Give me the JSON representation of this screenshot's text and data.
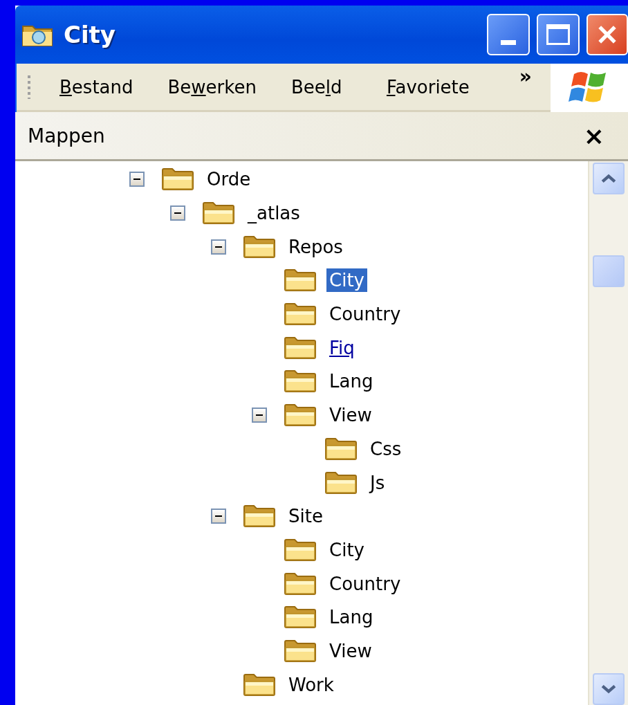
{
  "window": {
    "title": "City"
  },
  "menu": [
    {
      "segments": [
        {
          "text": "B",
          "underlined": true
        },
        {
          "text": "estand",
          "underlined": false
        }
      ]
    },
    {
      "segments": [
        {
          "text": "Be",
          "underlined": false
        },
        {
          "text": "w",
          "underlined": true
        },
        {
          "text": "erken",
          "underlined": false
        }
      ]
    },
    {
      "segments": [
        {
          "text": "Bee",
          "underlined": false
        },
        {
          "text": "l",
          "underlined": true
        },
        {
          "text": "d",
          "underlined": false
        }
      ]
    },
    {
      "segments": [
        {
          "text": "F",
          "underlined": true
        },
        {
          "text": "avoriete",
          "underlined": false
        }
      ]
    }
  ],
  "menu_overflow": "»",
  "folders_pane": {
    "title": "Mappen",
    "close": "×"
  },
  "tree": [
    {
      "label": "Orde",
      "expanded": true,
      "selected": false,
      "hovered": false,
      "children": [
        {
          "label": "_atlas",
          "expanded": true,
          "selected": false,
          "hovered": false,
          "children": [
            {
              "label": "Repos",
              "expanded": true,
              "selected": false,
              "hovered": false,
              "children": [
                {
                  "label": "City",
                  "selected": true,
                  "hovered": false
                },
                {
                  "label": "Country",
                  "selected": false,
                  "hovered": false
                },
                {
                  "label": "Fiq",
                  "selected": false,
                  "hovered": true
                },
                {
                  "label": "Lang",
                  "selected": false,
                  "hovered": false
                },
                {
                  "label": "View",
                  "expanded": true,
                  "selected": false,
                  "hovered": false,
                  "children": [
                    {
                      "label": "Css",
                      "selected": false,
                      "hovered": false
                    },
                    {
                      "label": "Js",
                      "selected": false,
                      "hovered": false
                    }
                  ]
                }
              ]
            },
            {
              "label": "Site",
              "expanded": true,
              "selected": false,
              "hovered": false,
              "children": [
                {
                  "label": "City",
                  "selected": false,
                  "hovered": false
                },
                {
                  "label": "Country",
                  "selected": false,
                  "hovered": false
                },
                {
                  "label": "Lang",
                  "selected": false,
                  "hovered": false
                },
                {
                  "label": "View",
                  "selected": false,
                  "hovered": false
                }
              ]
            },
            {
              "label": "Work",
              "selected": false,
              "hovered": false
            }
          ]
        }
      ]
    }
  ]
}
